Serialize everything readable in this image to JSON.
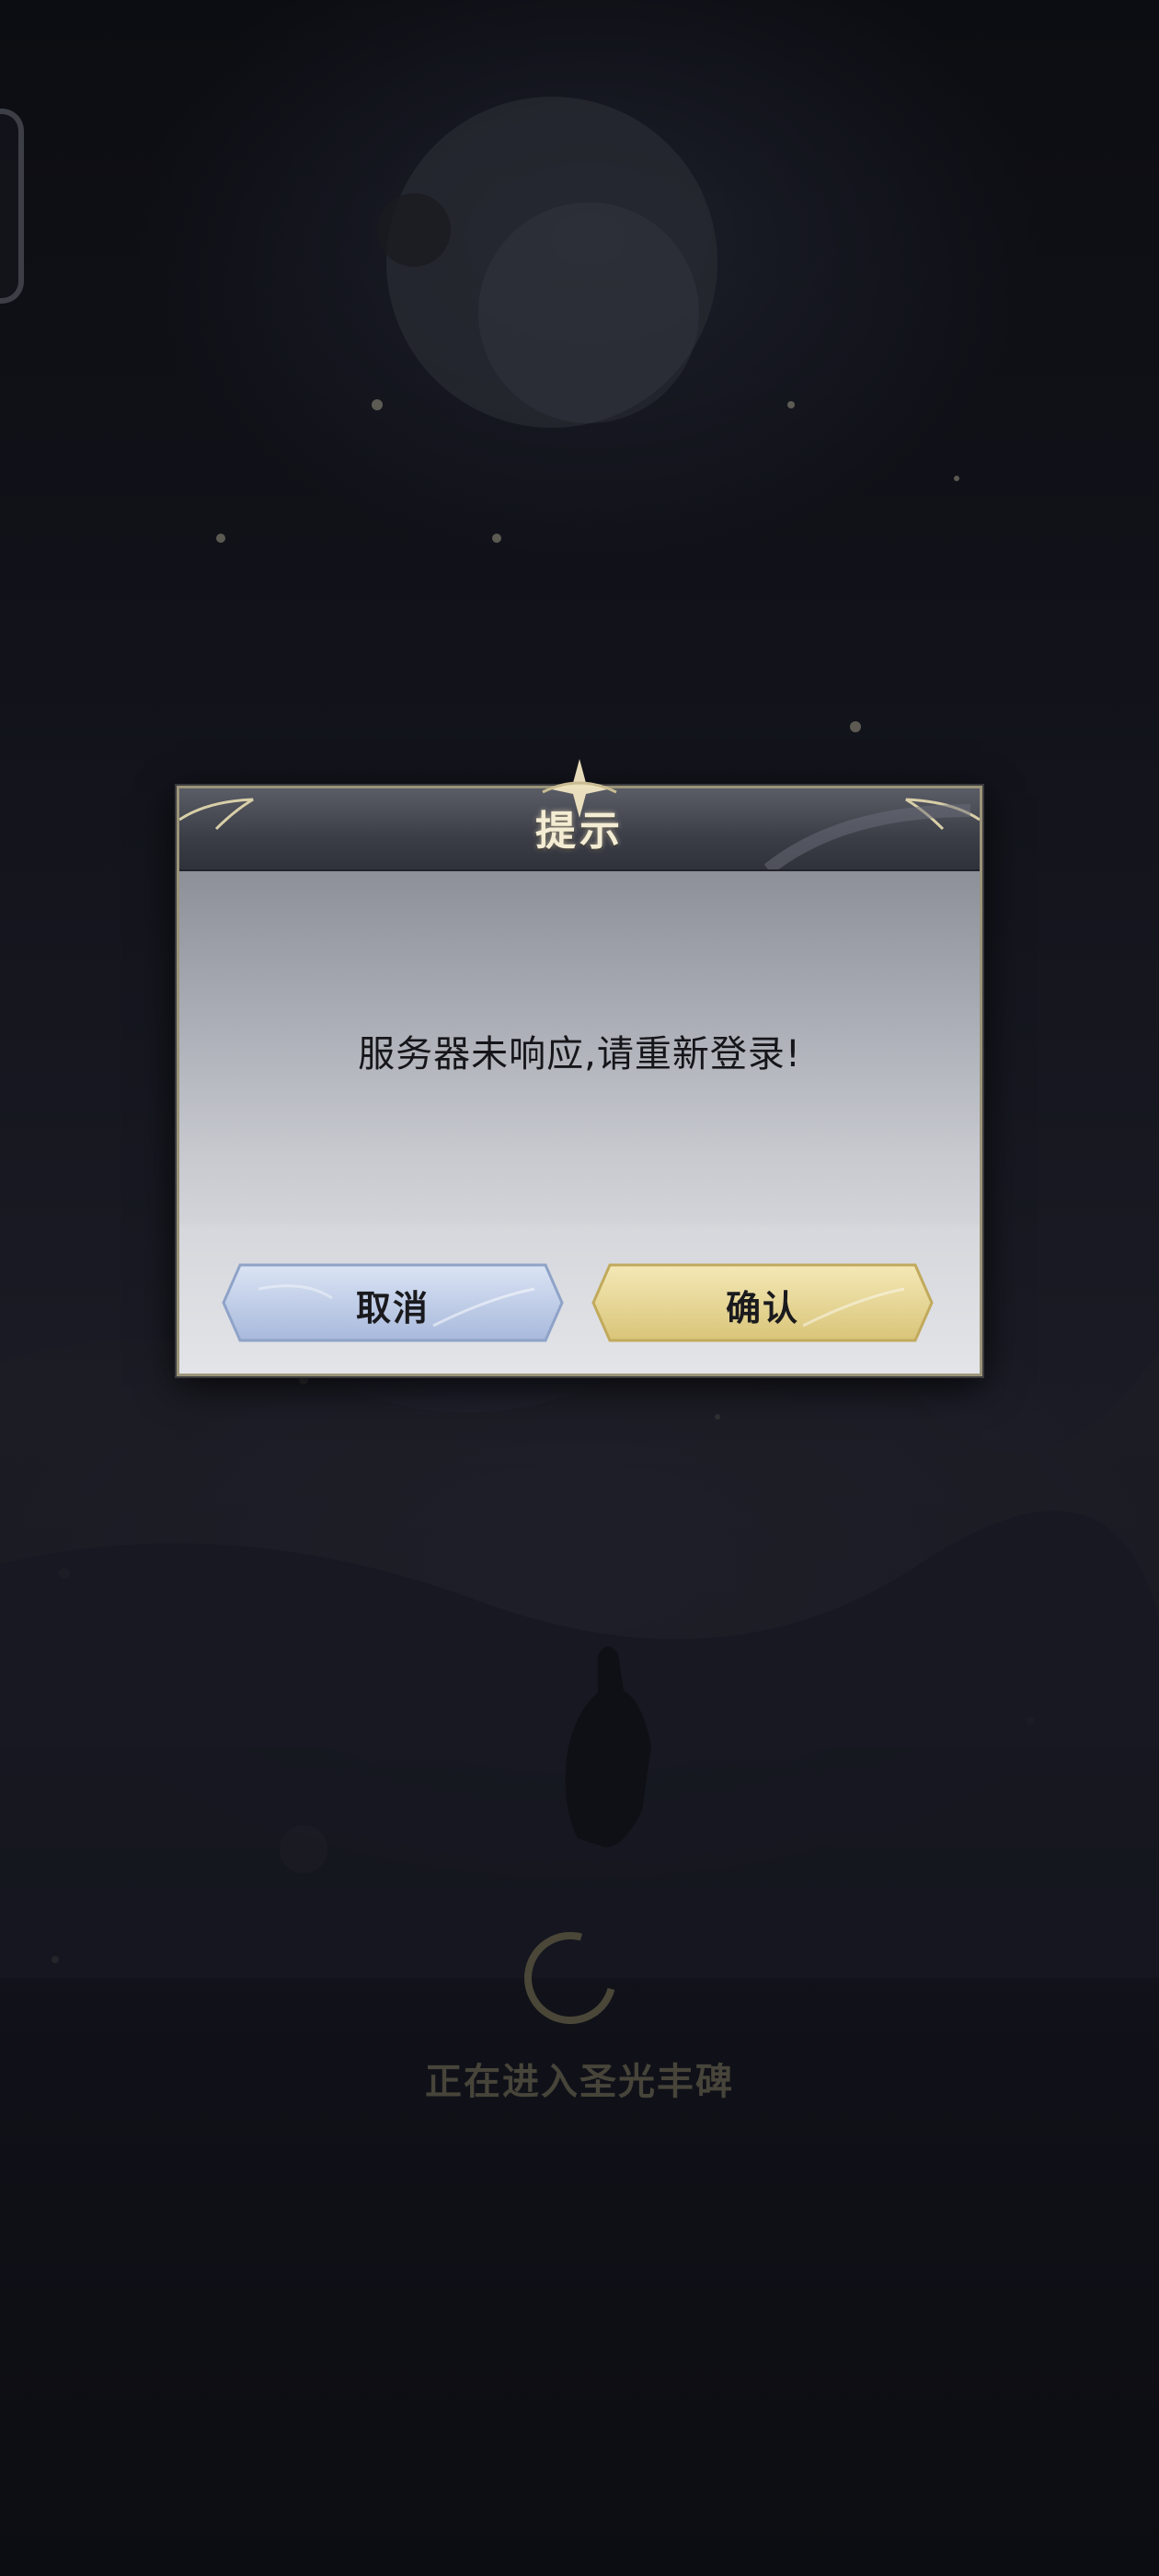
{
  "dialog": {
    "title": "提示",
    "message": "服务器未响应,请重新登录!",
    "cancel_label": "取消",
    "confirm_label": "确认"
  },
  "loading": {
    "text": "正在进入圣光丰碑"
  },
  "colors": {
    "background": "#0d0e14",
    "dialog_header": "#3b3d47",
    "dialog_border": "#9b9479",
    "cancel_button": "#b9c7e2",
    "confirm_button": "#e6d48f",
    "title_text": "#f4ecd3",
    "loading_text": "#47443a"
  },
  "icons": {
    "spinner": "loading-spinner-icon",
    "ornament": "star-ornament-icon",
    "side_tab": "side-tab-handle"
  }
}
